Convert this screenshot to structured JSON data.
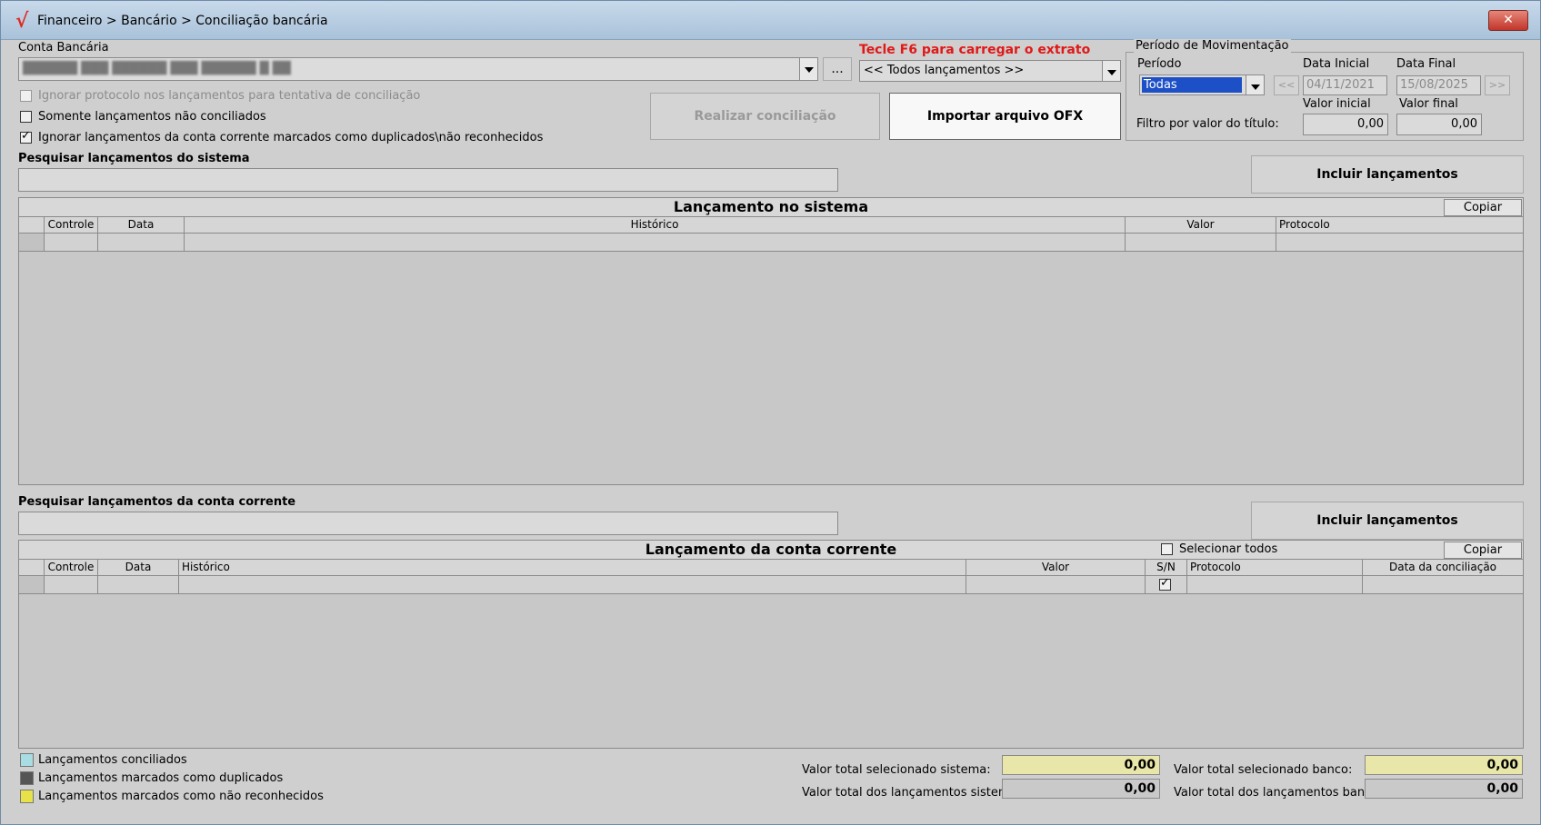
{
  "window": {
    "title": "Financeiro > Bancário > Conciliação bancária",
    "close_label": "✕"
  },
  "conta": {
    "label": "Conta Bancária",
    "value": "██████ ███ ██████ ███ ██████ █ ██",
    "dots_label": "..."
  },
  "f6_hint": "Tecle F6 para carregar o extrato",
  "lancamentos_combo": {
    "value": "<< Todos lançamentos >>"
  },
  "options": {
    "ignorar_protocolo": "Ignorar protocolo nos lançamentos para tentativa de conciliação",
    "somente_nao_conciliados": "Somente lançamentos não conciliados",
    "ignorar_duplicados": "Ignorar lançamentos da conta corrente marcados como duplicados\\não reconhecidos"
  },
  "buttons": {
    "realizar": "Realizar conciliação",
    "importar": "Importar arquivo OFX",
    "incluir": "Incluir lançamentos"
  },
  "periodo": {
    "group_label": "Período de Movimentação",
    "periodo_label": "Período",
    "periodo_value": "Todas",
    "prev": "<<",
    "next": ">>",
    "data_inicial_label": "Data Inicial",
    "data_inicial": "04/11/2021",
    "data_final_label": "Data Final",
    "data_final": "15/08/2025",
    "valor_inicial_label": "Valor inicial",
    "valor_final_label": "Valor final",
    "filtro_label": "Filtro por valor do título:",
    "valor_inicial": "0,00",
    "valor_final": "0,00"
  },
  "sistema": {
    "search_label": "Pesquisar lançamentos do sistema",
    "grid_title": "Lançamento no sistema",
    "copy_label": "Copiar",
    "columns": [
      "Controle",
      "Data",
      "Histórico",
      "Valor",
      "Protocolo"
    ]
  },
  "corrente": {
    "search_label": "Pesquisar lançamentos da conta corrente",
    "grid_title": "Lançamento da conta corrente",
    "select_all": "Selecionar todos",
    "copy_label": "Copiar",
    "columns": [
      "Controle",
      "Data",
      "Histórico",
      "Valor",
      "S/N",
      "Protocolo",
      "Data da conciliação"
    ]
  },
  "legend": {
    "items": [
      {
        "label": "Lançamentos conciliados",
        "color": "#a8dde4"
      },
      {
        "label": "Lançamentos marcados como duplicados",
        "color": "#555555"
      },
      {
        "label": "Lançamentos marcados como não reconhecidos",
        "color": "#e7e24a"
      }
    ]
  },
  "totals": {
    "sel_sistema_label": "Valor total selecionado sistema:",
    "sel_sistema": "0,00",
    "tot_sistema_label": "Valor total dos lançamentos sistema:",
    "tot_sistema": "0,00",
    "sel_banco_label": "Valor total selecionado banco:",
    "sel_banco": "0,00",
    "tot_banco_label": "Valor total dos lançamentos banco:",
    "tot_banco": "0,00"
  },
  "colors": {
    "highlight_yellow": "#e8e6a8",
    "hint_red": "#e01818",
    "selected_blue": "#1d4fc7"
  }
}
